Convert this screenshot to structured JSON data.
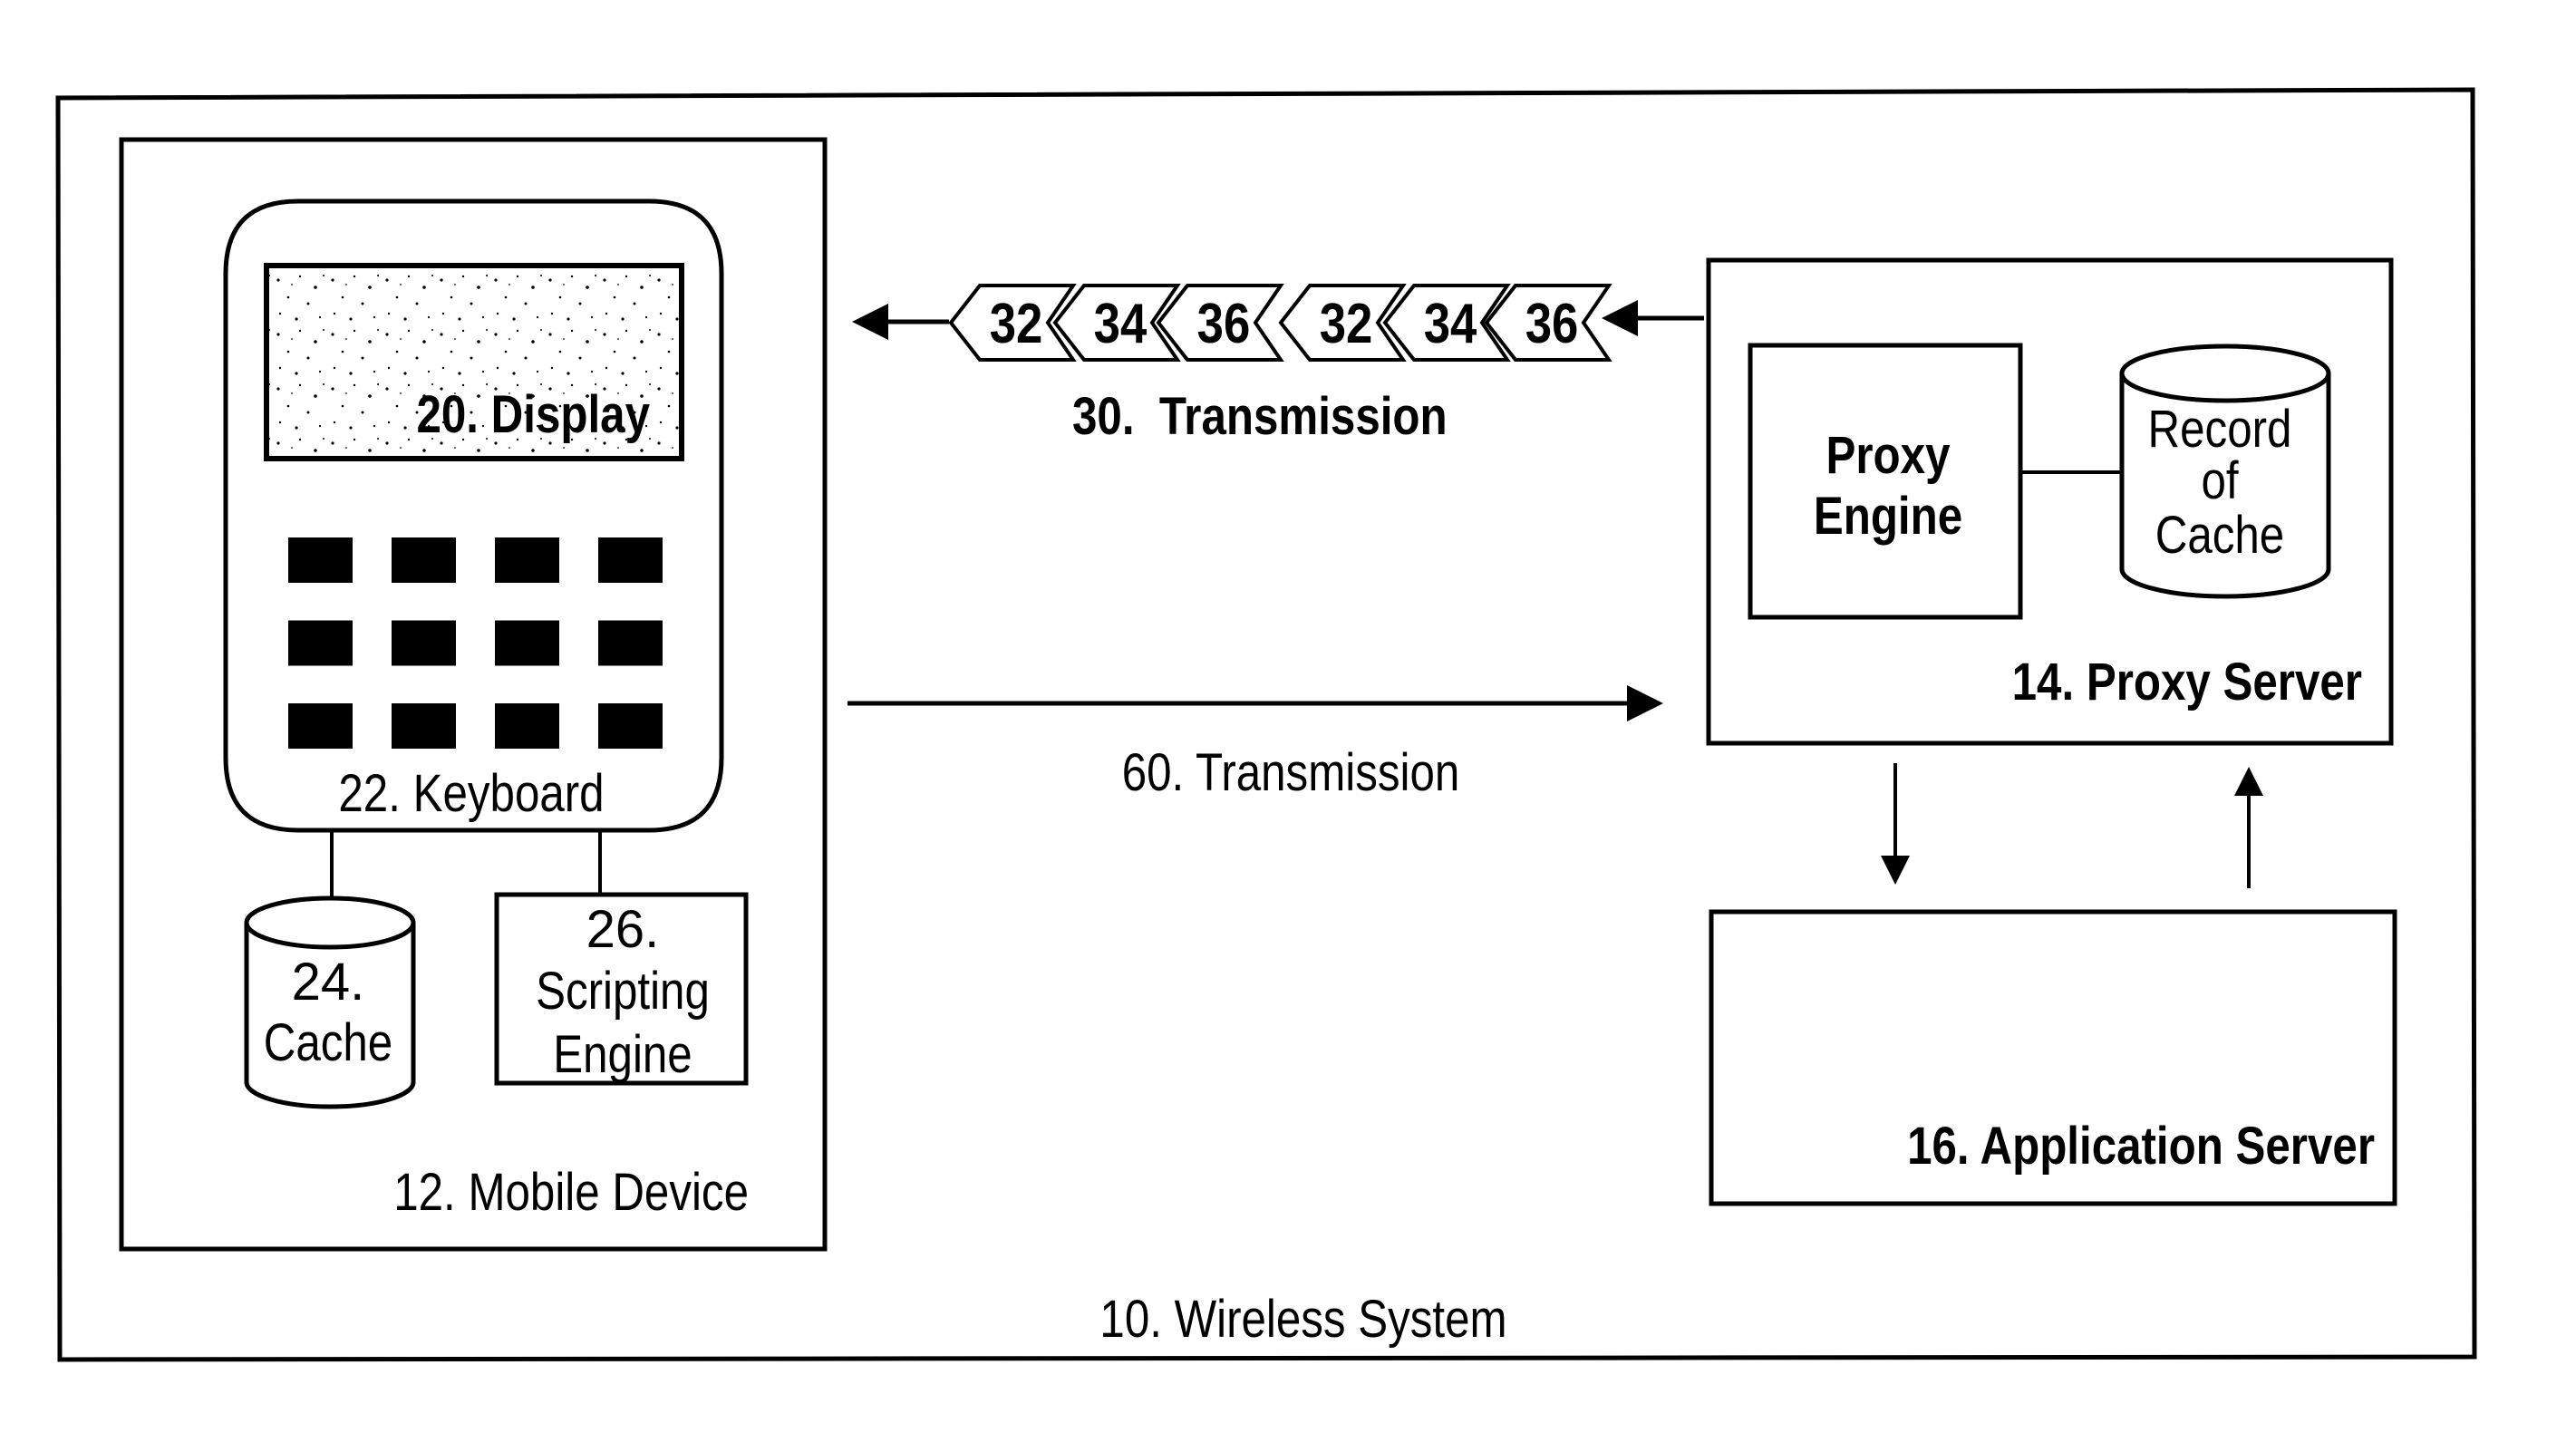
{
  "diagram": {
    "system_label": "10. Wireless System",
    "mobile_device": {
      "label": "12. Mobile Device",
      "display_label": "20. Display",
      "keyboard_label": "22. Keyboard",
      "keyboard_keys": {
        "rows": 3,
        "cols": 4
      },
      "cache": {
        "line1": "24.",
        "line2": "Cache"
      },
      "scripting_engine": {
        "line1": "26.",
        "line2": "Scripting",
        "line3": "Engine"
      }
    },
    "transmission_30": {
      "label": "30.  Transmission",
      "packets": [
        "32",
        "34",
        "36",
        "32",
        "34",
        "36"
      ],
      "direction": "proxy-server-to-mobile-device"
    },
    "transmission_60": {
      "label": "60. Transmission",
      "direction": "mobile-device-to-proxy-server"
    },
    "proxy_server": {
      "label": "14. Proxy Server",
      "engine": {
        "line1": "Proxy",
        "line2": "Engine"
      },
      "record_of_cache": {
        "line1": "Record",
        "line2": "of",
        "line3": "Cache"
      }
    },
    "application_server": {
      "label": "16. Application Server"
    },
    "colors": {
      "line": "#000000",
      "background": "#ffffff"
    }
  }
}
